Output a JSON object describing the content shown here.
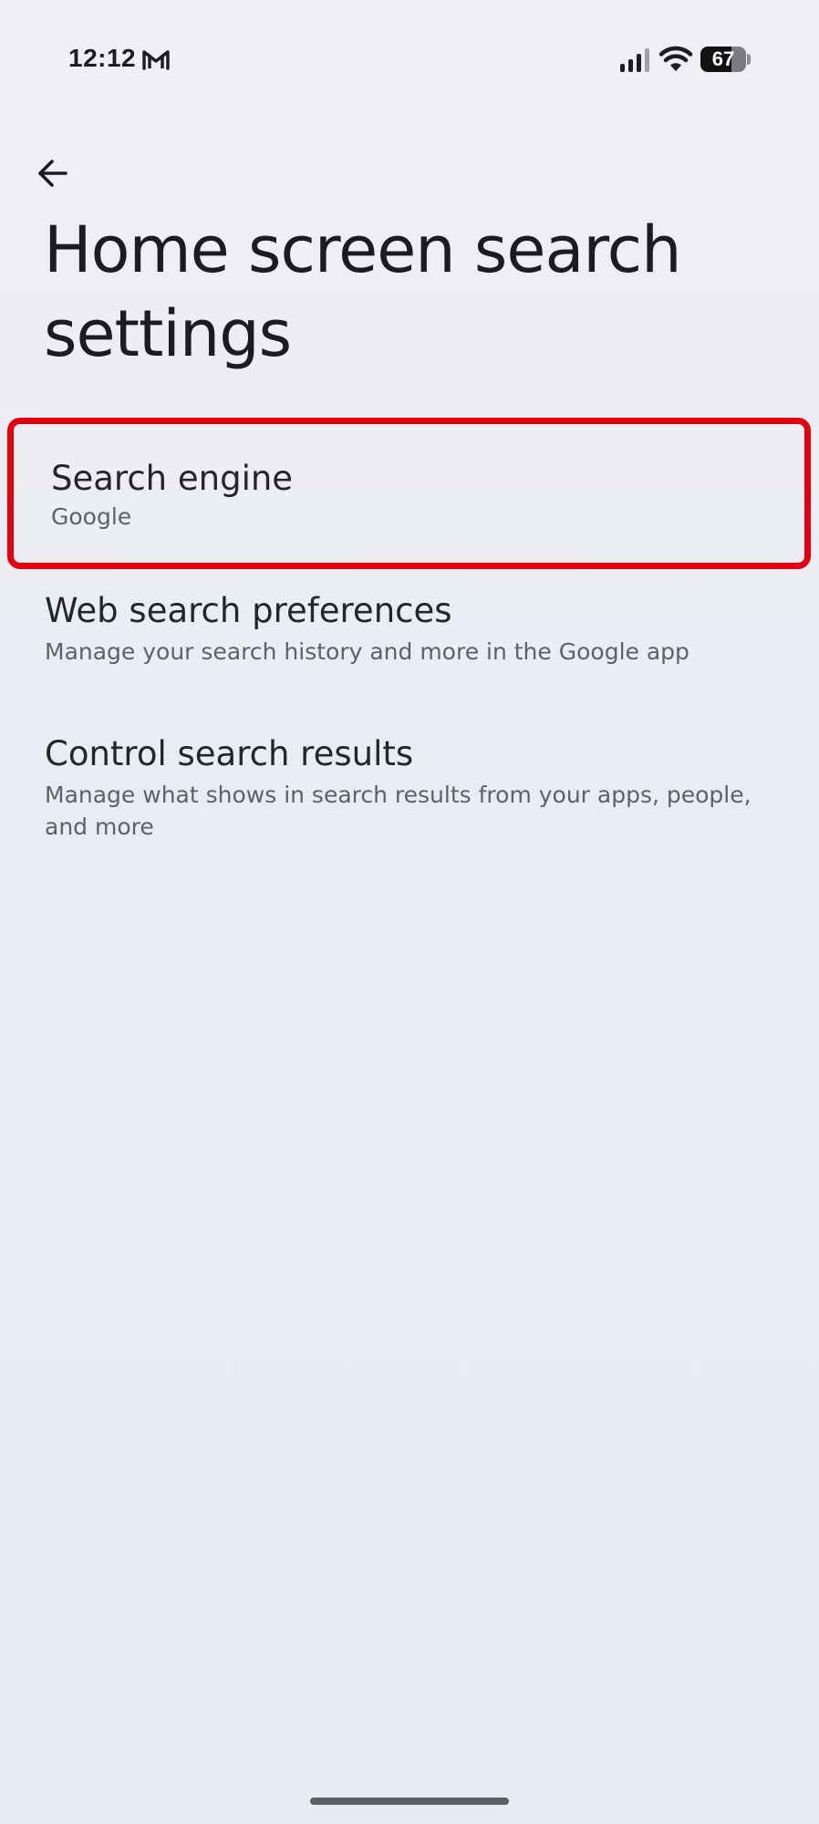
{
  "status_bar": {
    "time": "12:12",
    "notification_icon": "gmail-icon",
    "battery_level": 67,
    "battery_label": "67"
  },
  "header": {
    "back_icon": "arrow-left-icon",
    "title": "Home screen search settings"
  },
  "settings": [
    {
      "title": "Search engine",
      "subtitle": "Google",
      "highlighted": true
    },
    {
      "title": "Web search preferences",
      "subtitle": "Manage your search history and more in the Google app"
    },
    {
      "title": "Control search results",
      "subtitle": "Manage what shows in search results from your apps, people, and more"
    }
  ],
  "colors": {
    "highlight_border": "#e4000f",
    "background": "#e9ecf3",
    "title_text": "#1b1c20",
    "subtitle_text": "#5f6168"
  }
}
